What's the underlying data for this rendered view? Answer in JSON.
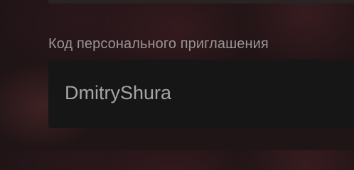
{
  "invite_section": {
    "label": "Код персонального приглашения",
    "value": "DmitryShura"
  }
}
